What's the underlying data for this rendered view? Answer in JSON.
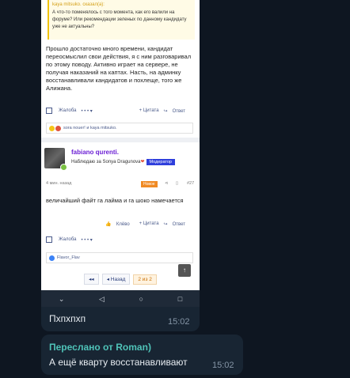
{
  "forum": {
    "quote_author": "kaya mitsuko. сказал(а):",
    "quote_text": "А что-то поменялось с того момента, как его валили на форуме? Или рекомендации зеленых по данному кандидату уже не актуальны?",
    "post1_text": "Прошло достаточно много времени, кандидат переосмыслил свои действия, я с ним разговаривал по этому поводу. Активно играет на сервере, не получая наказаний на каптах. Насть, на админку восстанавливали кандидатов и похлеще, того же Алижана.",
    "actions1": {
      "report": "Жалоба",
      "dots": "• • • ▾",
      "quote": "+ Цитата",
      "reply": "Ответ"
    },
    "likes1": "sora nouer! и kaya mitsuko.",
    "author_name": "fabiano qurenti.",
    "author_watch": "Наблюдаю за Sonya Dragunova",
    "moderator_badge": "Модератор",
    "post2_time": "4 мин. назад",
    "new_badge": "Новое",
    "post_number": "#27",
    "post2_text": "величайший файт га лайма и га шоко намечается",
    "actions2": {
      "like": "Клёво",
      "quote": "+ Цитата",
      "reply": "Ответ",
      "report": "Жалоба",
      "dots": "• • • ▾"
    },
    "likes2": "Flavor_Flav",
    "pager": {
      "back": "◂ Назад",
      "first": "◂◂",
      "current": "2 из 2"
    }
  },
  "navbar": {
    "down": "⌄",
    "back": "◁",
    "home": "○",
    "recent": "□"
  },
  "chat": {
    "msg1_text": "Пхпхпхп",
    "msg1_time": "15:02",
    "msg2_forward": "Переслано от Roman)",
    "msg2_text": "А ещё кварту восстанавливают",
    "msg2_time": "15:02"
  },
  "colors": {
    "chat_bg": "#0e1621",
    "bubble": "#182533",
    "forward": "#4fc3b8",
    "author": "#6b1fd4",
    "mod_badge": "#2f3fdc",
    "new_badge": "#f08a24"
  }
}
